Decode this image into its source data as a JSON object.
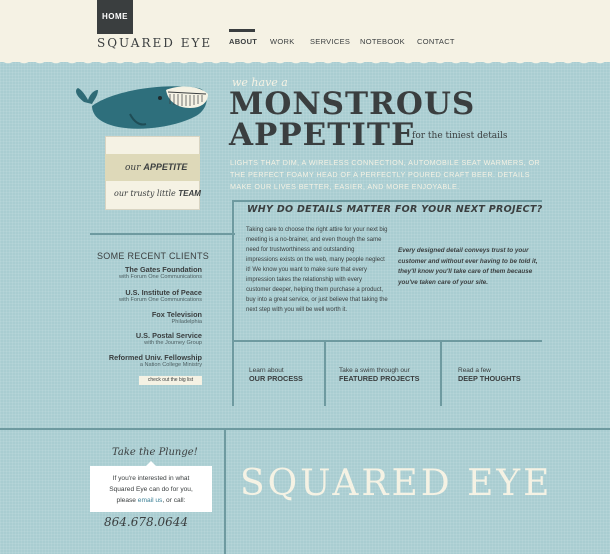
{
  "header": {
    "home_tab": "HOME",
    "logo": "SQUARED EYE",
    "nav": [
      "ABOUT",
      "WORK",
      "SERVICES",
      "NOTEBOOK",
      "CONTACT"
    ]
  },
  "sidebar": {
    "items": [
      {
        "prefix": "our ",
        "label": "APPETITE"
      },
      {
        "prefix": "our trusty little ",
        "label": "TEAM"
      }
    ]
  },
  "hero": {
    "we_have": "we have a",
    "line1": "MONSTROUS",
    "line2": "APPETITE",
    "tagline": "for the tiniest details",
    "intro": "Lights that dim, a wireless connection, automobile seat warmers, or the perfect foamy head of a perfectly poured craft beer. Details make our lives better, easier, and more enjoyable."
  },
  "why": {
    "heading": "WHY DO DETAILS MATTER FOR YOUR NEXT PROJECT?",
    "body": "Taking care to choose the right attire for your next big meeting is a no-brainer, and even though the same need for trustworthiness and outstanding impressions exists on the web, many people neglect it! We know you want to make sure that every impression takes the relationship with every customer deeper, helping them purchase a product, buy into a great service, or just believe that taking the next step with you will be well worth it.",
    "quote": "Every designed detail conveys trust to your customer and without ever having to be told it, they'll know you'll take care of them because you've taken care of your site."
  },
  "clients": {
    "title": "SOME RECENT CLIENTS",
    "list": [
      {
        "name": "The Gates Foundation",
        "sub": "with Forum One Communications"
      },
      {
        "name": "U.S. Institute of Peace",
        "sub": "with Forum One Communications"
      },
      {
        "name": "Fox Television",
        "sub": "Philadelphia"
      },
      {
        "name": "U.S. Postal Service",
        "sub": "with the Journey Group"
      },
      {
        "name": "Reformed Univ. Fellowship",
        "sub": "a Nation College Ministry"
      }
    ],
    "big_list": "check out the big list"
  },
  "features": [
    {
      "lead": "Learn about",
      "title": "OUR PROCESS"
    },
    {
      "lead": "Take a swim through our",
      "title": "FEATURED PROJECTS"
    },
    {
      "lead": "Read a few",
      "title": "DEEP THOUGHTS"
    }
  ],
  "contact": {
    "plunge": "Take the Plunge!",
    "line1": "If you're interested in what",
    "line2": "Squared Eye can do for you,",
    "line3a": "please ",
    "email_link": "email us",
    "line3b": ", or call:",
    "phone": "864.678.0644"
  },
  "footer": {
    "logo": "SQUARED EYE"
  },
  "colors": {
    "background": "#a9cdd1",
    "cream": "#f5f2e4",
    "ink": "#3a3e3f",
    "line": "#6e9aa0"
  }
}
